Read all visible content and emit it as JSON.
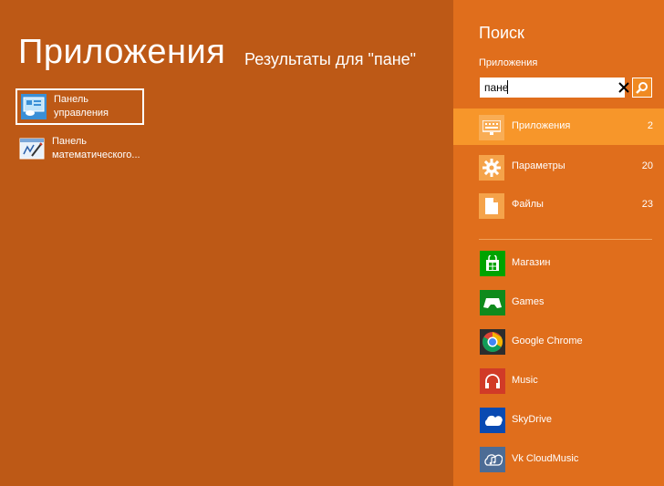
{
  "main": {
    "title": "Приложения",
    "subtitle": "Результаты для \"пане\"",
    "results": [
      {
        "line1": "Панель",
        "line2": "управления",
        "icon": "control-panel-icon"
      },
      {
        "line1": "Панель",
        "line2": "математического...",
        "icon": "math-input-panel-icon"
      }
    ]
  },
  "pane": {
    "title": "Поиск",
    "scope_label": "Приложения",
    "search_value": "пане",
    "categories": [
      {
        "label": "Приложения",
        "count": "2",
        "icon": "keyboard-icon"
      },
      {
        "label": "Параметры",
        "count": "20",
        "icon": "gear-icon"
      },
      {
        "label": "Файлы",
        "count": "23",
        "icon": "file-icon"
      }
    ],
    "apps": [
      {
        "label": "Магазин",
        "icon": "store-icon",
        "color": "#00a300"
      },
      {
        "label": "Games",
        "icon": "gamepad-icon",
        "color": "#0f8a1c"
      },
      {
        "label": "Google Chrome",
        "icon": "chrome-icon",
        "color": "#2d2d2d"
      },
      {
        "label": "Music",
        "icon": "headphones-icon",
        "color": "#d13b27"
      },
      {
        "label": "SkyDrive",
        "icon": "cloud-icon",
        "color": "#094ab2"
      },
      {
        "label": "Vk CloudMusic",
        "icon": "cloud-music-icon",
        "color": "#4c6c95"
      }
    ]
  },
  "colors": {
    "main_bg": "#bd5916",
    "pane_bg": "#e06e1c",
    "active_bg": "#f7962a"
  }
}
